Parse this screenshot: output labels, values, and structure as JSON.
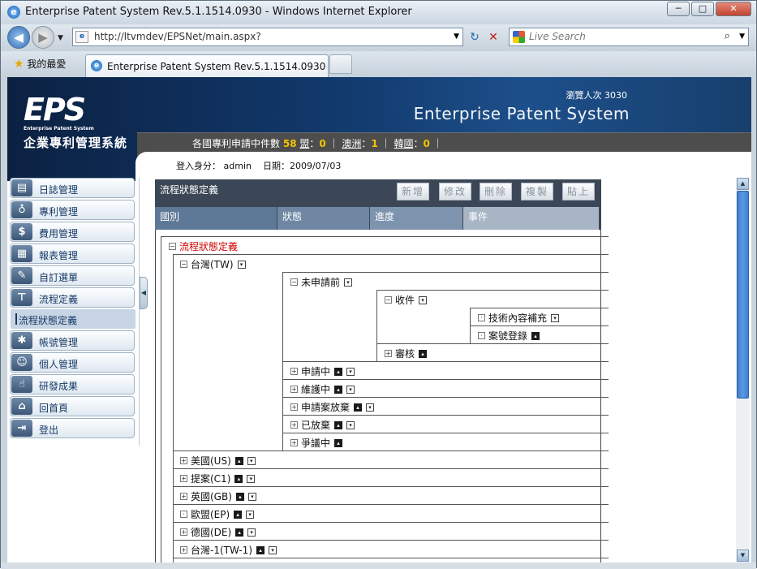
{
  "browser": {
    "title": "Enterprise Patent System Rev.5.1.1514.0930 - Windows Internet Explorer",
    "url": "http://ltvmdev/EPSNet/main.aspx?",
    "search_placeholder": "Live Search",
    "favorites_label": "我的最愛",
    "tab_title": "Enterprise Patent System Rev.5.1.1514.0930",
    "min_btn": "─",
    "max_btn": "□",
    "close_btn": "✕"
  },
  "banner": {
    "logo_text": "EPS",
    "logo_sub": "Enterprise Patent System",
    "logo_cn": "企業專利管理系統",
    "visit_label": "瀏覽人次",
    "visit_count": "3030",
    "system_name": "Enterprise Patent System",
    "stats_prefix": "各國專利申請中件數",
    "stats_total": "58",
    "stats_items": [
      {
        "label": "盟",
        "value": "0"
      },
      {
        "label": "澳洲",
        "value": "1"
      },
      {
        "label": "韓國",
        "value": "0"
      }
    ],
    "login_label": "登入身分：",
    "login_user": "admin",
    "date_label": "日期：",
    "date_value": "2009/07/03"
  },
  "sidebar": {
    "items": [
      {
        "label": "日誌管理",
        "icon": "journal-icon"
      },
      {
        "label": "專利管理",
        "icon": "lightbulb-icon"
      },
      {
        "label": "費用管理",
        "icon": "dollar-icon"
      },
      {
        "label": "報表管理",
        "icon": "report-icon"
      },
      {
        "label": "自訂選單",
        "icon": "custom-menu-icon"
      },
      {
        "label": "流程定義",
        "icon": "flowchart-icon"
      },
      {
        "label": "帳號管理",
        "icon": "account-icon"
      },
      {
        "label": "個人管理",
        "icon": "person-icon"
      },
      {
        "label": "研發成果",
        "icon": "thumbs-up-icon"
      },
      {
        "label": "回首頁",
        "icon": "home-icon"
      },
      {
        "label": "登出",
        "icon": "logout-icon"
      }
    ],
    "submenu_label": "流程狀態定義"
  },
  "panel": {
    "title": "流程狀態定義",
    "buttons": [
      "新增",
      "修改",
      "刪除",
      "複製",
      "貼上"
    ],
    "columns": [
      "國別",
      "狀態",
      "進度",
      "事件"
    ]
  },
  "tree": {
    "root": "流程狀態定義",
    "tw": "台灣(TW)",
    "tw_states": [
      "未申請前",
      "申請中",
      "維護中",
      "申請案放棄",
      "已放棄",
      "爭議中"
    ],
    "unapplied_progress": [
      "收件",
      "審核"
    ],
    "receipt_events": [
      "技術內容補充",
      "案號登錄"
    ],
    "countries": [
      "美國(US)",
      "提案(C1)",
      "英國(GB)",
      "歐盟(EP)",
      "德國(DE)",
      "台灣-1(TW-1)"
    ]
  },
  "colors": {
    "banner_dark": "#0b2142",
    "stats_highlight": "#f4c400",
    "root_red": "#d00000",
    "toolbar_bg": "#3b4756"
  }
}
